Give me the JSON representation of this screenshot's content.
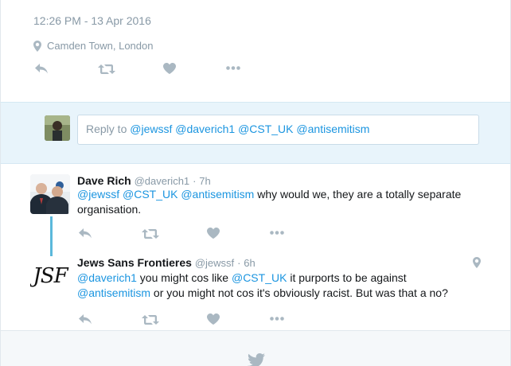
{
  "top_tweet": {
    "timestamp": "12:26 PM - 13 Apr 2016",
    "location": "Camden Town, London"
  },
  "reply_box": {
    "prefix": "Reply to",
    "mentions": [
      "@jewssf",
      "@daverich1",
      "@CST_UK",
      "@antisemitism"
    ]
  },
  "replies": [
    {
      "name": "Dave Rich",
      "handle": "@daverich1",
      "separator": "·",
      "time": "7h",
      "line1": [
        {
          "text": "@jewssf",
          "link": true
        },
        {
          "text": " ",
          "link": false
        },
        {
          "text": "@CST_UK",
          "link": true
        },
        {
          "text": " ",
          "link": false
        },
        {
          "text": "@antisemitism",
          "link": true
        },
        {
          "text": " why would we, they are a totally separate",
          "link": false
        }
      ],
      "line2": "organisation."
    },
    {
      "name": "Jews Sans Frontieres",
      "handle": "@jewssf",
      "separator": "·",
      "time": "6h",
      "avatar_text": "JSF",
      "line1": [
        {
          "text": "@daverich1",
          "link": true
        },
        {
          "text": " you might cos like ",
          "link": false
        },
        {
          "text": "@CST_UK",
          "link": true
        },
        {
          "text": " it purports to be against",
          "link": false
        }
      ],
      "line2": [
        {
          "text": "@antisemitism",
          "link": true
        },
        {
          "text": " or you might not cos it's obviously racist. But was that a no?",
          "link": false
        }
      ]
    }
  ],
  "colors": {
    "link": "#1b95e0",
    "icon": "#aab8c2",
    "meta": "#8899a6",
    "reply_bg": "#e8f4fb",
    "thread_line": "#5bb8db",
    "bird": "#aab8c2"
  },
  "icons": [
    "location-pin-icon",
    "reply-icon",
    "retweet-icon",
    "like-heart-icon",
    "more-dots-icon",
    "twitter-bird-icon"
  ]
}
